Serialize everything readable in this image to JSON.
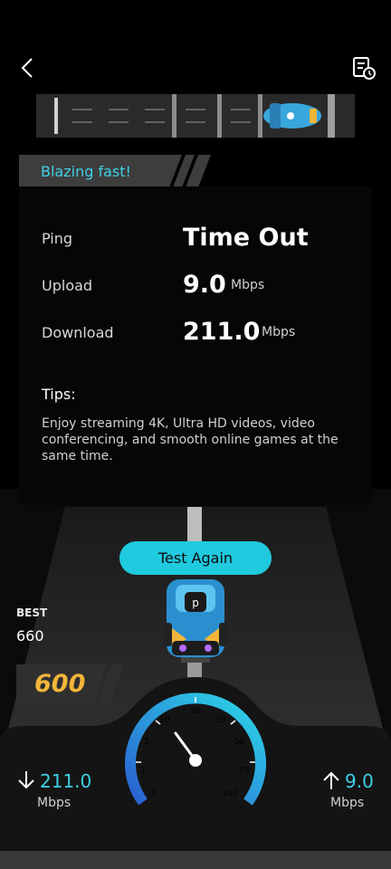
{
  "status_banner": "Blazing fast!",
  "results": {
    "ping_label": "Ping",
    "ping_value": "Time Out",
    "upload_label": "Upload",
    "upload_value": "9.0",
    "upload_unit": "Mbps",
    "download_label": "Download",
    "download_value": "211.0",
    "download_unit": "Mbps"
  },
  "tips": {
    "title": "Tips:",
    "text": "Enjoy streaming 4K, Ultra HD videos, video conferencing, and smooth online games at the same time."
  },
  "test_again_label": "Test Again",
  "best": {
    "label": "BEST",
    "value": "660"
  },
  "score": "600",
  "dashboard": {
    "download_value": "211.0",
    "download_unit": "Mbps",
    "upload_value": "9.0",
    "upload_unit": "Mbps",
    "gauge_ticks": [
      "0",
      "1",
      "5",
      "10",
      "20",
      "30",
      "50",
      "75",
      "100"
    ]
  },
  "icons": {
    "back": "back-arrow-icon",
    "history": "history-log-icon",
    "download_arrow": "arrow-down-icon",
    "upload_arrow": "arrow-up-icon"
  },
  "colors": {
    "accent": "#1fc9de",
    "score": "#f2b53a",
    "background": "#000000"
  }
}
